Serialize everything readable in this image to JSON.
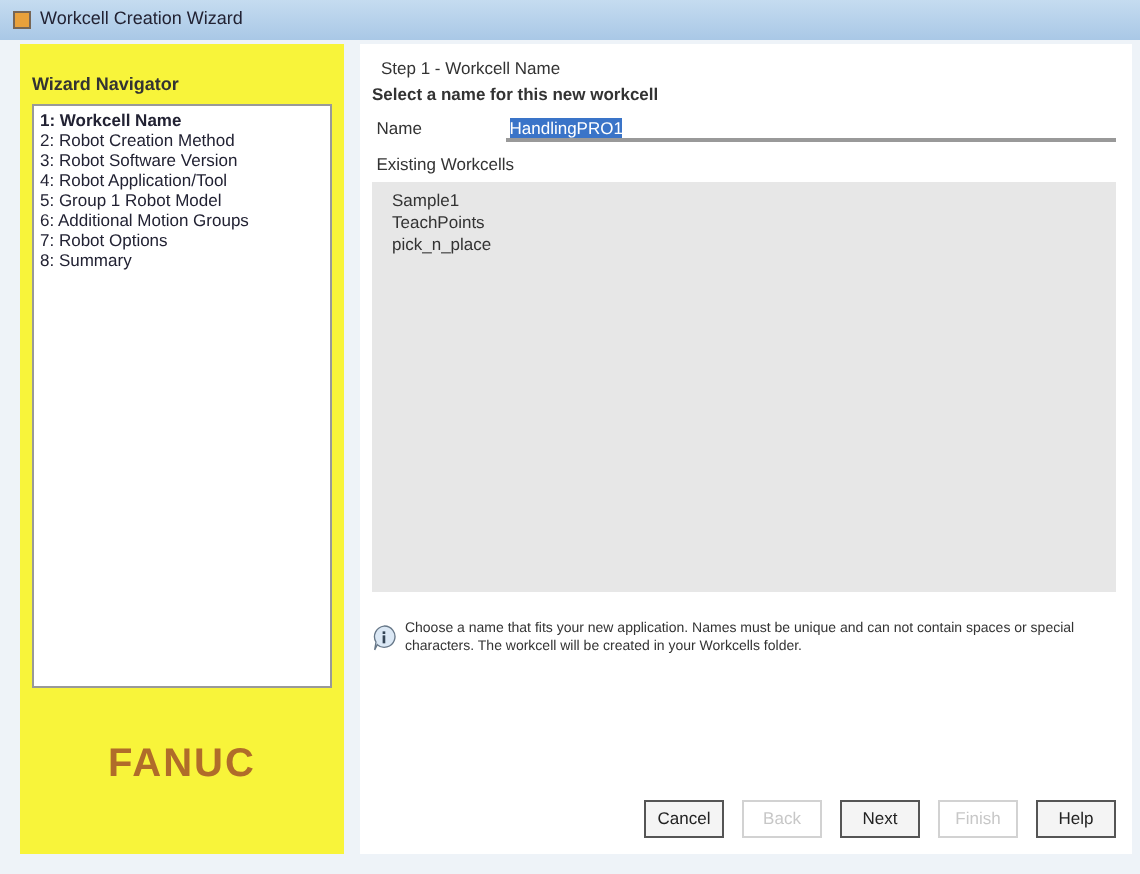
{
  "window": {
    "title": "Workcell Creation Wizard"
  },
  "navigator": {
    "title": "Wizard Navigator",
    "steps": [
      {
        "label": "1: Workcell Name",
        "selected": true
      },
      {
        "label": "2: Robot Creation Method",
        "selected": false
      },
      {
        "label": "3: Robot Software Version",
        "selected": false
      },
      {
        "label": "4: Robot Application/Tool",
        "selected": false
      },
      {
        "label": "5: Group 1 Robot Model",
        "selected": false
      },
      {
        "label": "6: Additional Motion Groups",
        "selected": false
      },
      {
        "label": "7: Robot Options",
        "selected": false
      },
      {
        "label": "8: Summary",
        "selected": false
      }
    ]
  },
  "logo": "FANUC",
  "step": {
    "heading": "Step 1 - Workcell Name",
    "prompt": "Select a name for this new workcell",
    "name_label": "Name",
    "name_value": "HandlingPRO1",
    "list_label": "Existing Workcells",
    "workcells": [
      "Sample1",
      "TeachPoints",
      "pick_n_place"
    ]
  },
  "info": "Choose a name that fits your new application. Names must be unique and can not contain spaces or special characters. The workcell will be created in your Workcells folder.",
  "buttons": [
    {
      "label": "Cancel",
      "disabled": false
    },
    {
      "label": "Back",
      "disabled": true
    },
    {
      "label": "Next",
      "disabled": false
    },
    {
      "label": "Finish",
      "disabled": true
    },
    {
      "label": "Help",
      "disabled": false
    }
  ]
}
